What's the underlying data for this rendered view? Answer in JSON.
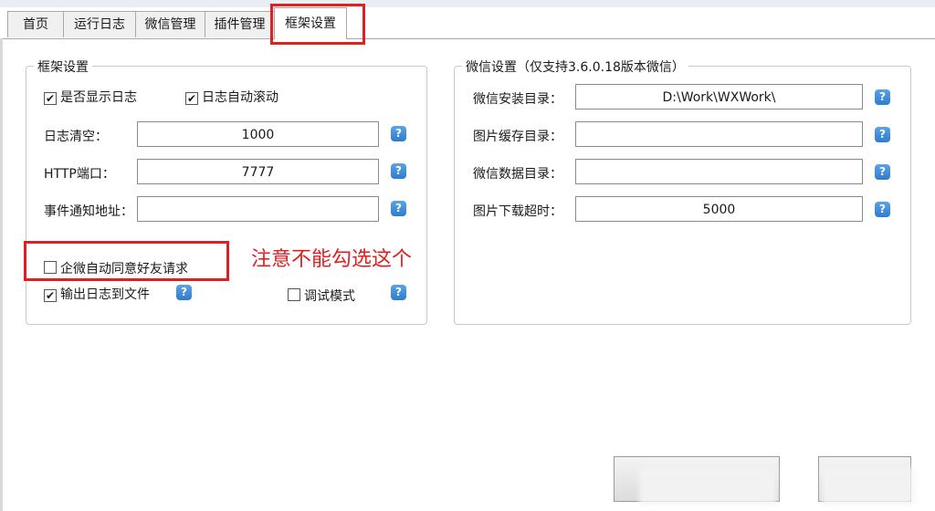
{
  "tabs": [
    "首页",
    "运行日志",
    "微信管理",
    "插件管理",
    "框架设置"
  ],
  "framework": {
    "title": "框架设置",
    "show_log": "是否显示日志",
    "auto_scroll": "日志自动滚动",
    "log_clear_label": "日志清空：",
    "log_clear_value": "1000",
    "http_port_label": "HTTP端口：",
    "http_port_value": "7777",
    "event_url_label": "事件通知地址：",
    "event_url_value": "",
    "auto_agree": "企微自动同意好友请求",
    "log_to_file": "输出日志到文件",
    "debug_mode": "调试模式"
  },
  "wechat": {
    "title": "微信设置（仅支持3.6.0.18版本微信）",
    "install_dir_label": "微信安装目录：",
    "install_dir_value": "D:\\Work\\WXWork\\",
    "img_cache_label": "图片缓存目录：",
    "img_cache_value": "",
    "data_dir_label": "微信数据目录：",
    "data_dir_value": "",
    "img_timeout_label": "图片下载超时：",
    "img_timeout_value": "5000"
  },
  "help_glyph": "?",
  "check_glyph": "✔",
  "annotation": "注意不能勾选这个",
  "colors": {
    "annotation_red": "#e02020",
    "help_blue": "#2e7cd0"
  },
  "checks": {
    "show_log": true,
    "auto_scroll": true,
    "auto_agree": false,
    "log_to_file": true,
    "debug_mode": false
  }
}
